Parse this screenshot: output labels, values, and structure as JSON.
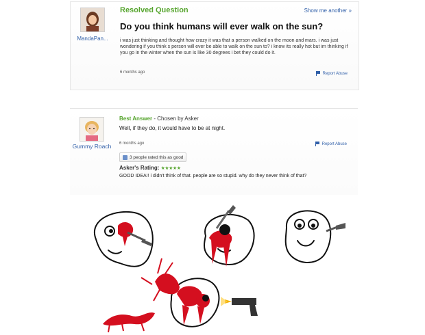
{
  "question": {
    "status_label": "Resolved Question",
    "show_another": "Show me another »",
    "asker_name": "MandaPan...",
    "title": "Do you think humans will ever walk on the sun?",
    "body": "i was just thinking and thought how crazy it was that a person walked on the moon and mars. i was just wondering if you think s person will ever be able to walk on the sun to? i know its really hot but im thinking if you go in the winter when the sun is like 30 degrees i bet they could do it.",
    "time": "6 months ago",
    "report": "Report Abuse"
  },
  "answer": {
    "best_label": "Best Answer",
    "chosen_by": " - Chosen by Asker",
    "answerer_name": "Gummy Roach",
    "text": "Well, if they do, it would have to be at night.",
    "time": "6 months ago",
    "report": "Report Abuse",
    "rated_text": "3 people rated this as good",
    "rating_label": "Asker's Rating:",
    "rating_stars": "★★★★★",
    "rating_comment": "GOOD IDEA!! i didn't think of that. people are so stupid. why do they never think of that?"
  },
  "colors": {
    "accent_green": "#57a52f",
    "link_blue": "#2f5ea8",
    "blood_red": "#d40f1f"
  },
  "icons": [
    "asker-avatar-icon",
    "answerer-avatar-icon",
    "flag-icon",
    "thumb-up-icon",
    "knife-icon",
    "gun-icon",
    "blood-splatter-icon"
  ]
}
